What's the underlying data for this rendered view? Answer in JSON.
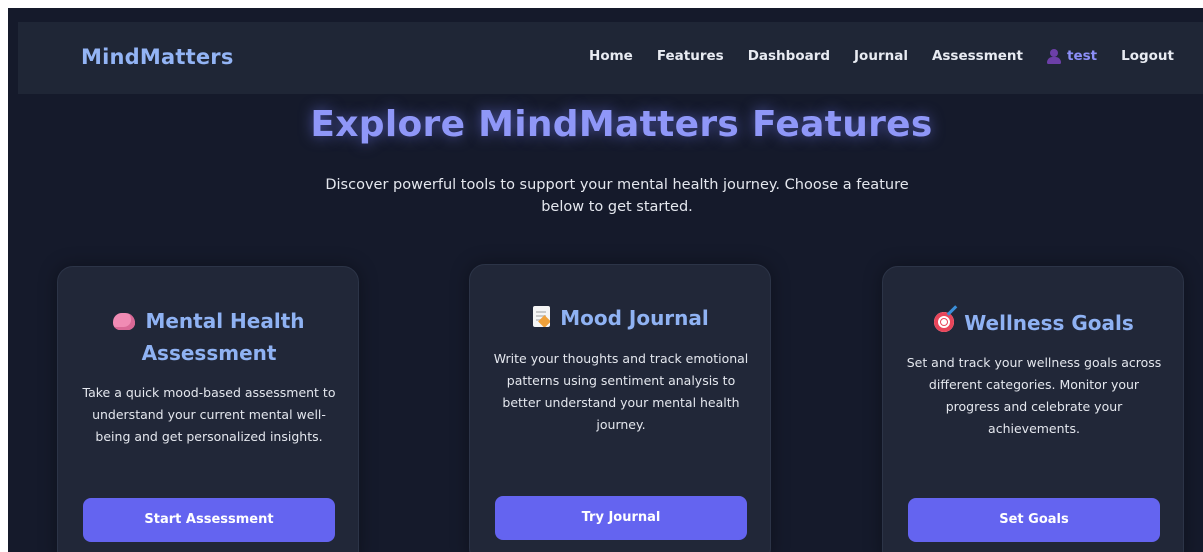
{
  "brand": "MindMatters",
  "nav": {
    "links": [
      "Home",
      "Features",
      "Dashboard",
      "Journal",
      "Assessment"
    ],
    "user_name": "test",
    "user_icon": "user-icon",
    "logout": "Logout"
  },
  "hero": {
    "title": "Explore MindMatters Features",
    "subtitle": "Discover powerful tools to support your mental health journey. Choose a feature below to get started."
  },
  "cards": [
    {
      "icon": "brain-icon",
      "title": "Mental Health Assessment",
      "description": "Take a quick mood-based assessment to understand your current mental well-being and get personalized insights.",
      "button": "Start Assessment"
    },
    {
      "icon": "memo-icon",
      "title": "Mood Journal",
      "description": "Write your thoughts and track emotional patterns using sentiment analysis to better understand your mental health journey.",
      "button": "Try Journal"
    },
    {
      "icon": "target-icon",
      "title": "Wellness Goals",
      "description": "Set and track your wellness goals across different categories. Monitor your progress and celebrate your achievements.",
      "button": "Set Goals"
    }
  ],
  "colors": {
    "background": "#151a2b",
    "navbar": "#1f2636",
    "card": "#212738",
    "accent": "#6464f0",
    "title": "#8f97f8",
    "card_title": "#8fb2f3"
  }
}
